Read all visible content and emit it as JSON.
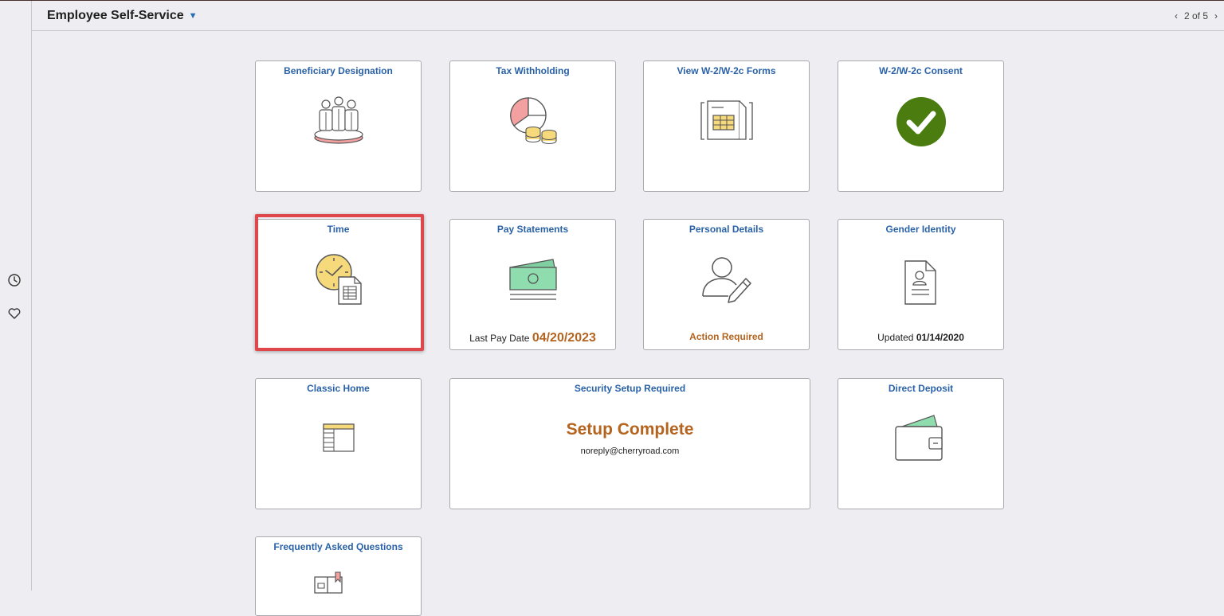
{
  "header": {
    "title": "Employee Self-Service",
    "pager": {
      "prev": "‹",
      "label": "2 of 5",
      "next": "›"
    }
  },
  "leftbar": {
    "icons": [
      "history-icon",
      "favorites-heart-icon"
    ]
  },
  "tiles": [
    {
      "title": "Beneficiary Designation",
      "icon": "people-on-platform-icon"
    },
    {
      "title": "Tax Withholding",
      "icon": "pie-chart-coins-icon"
    },
    {
      "title": "View W-2/W-2c Forms",
      "icon": "forms-document-icon"
    },
    {
      "title": "W-2/W-2c Consent",
      "icon": "green-checkmark-icon"
    },
    {
      "title": "Time",
      "icon": "clock-timesheet-icon"
    },
    {
      "title": "Pay Statements",
      "icon": "money-bill-icon",
      "footer_label": "Last Pay Date",
      "footer_value": "04/20/2023"
    },
    {
      "title": "Personal Details",
      "icon": "person-edit-icon",
      "footer_value": "Action Required"
    },
    {
      "title": "Gender Identity",
      "icon": "profile-document-icon",
      "footer_label": "Updated",
      "footer_value": "01/14/2020"
    },
    {
      "title": "Classic Home",
      "icon": "classic-page-icon"
    },
    {
      "title": "Security Setup Required",
      "headline": "Setup Complete",
      "email": "noreply@cherryroad.com"
    },
    {
      "title": "Direct Deposit",
      "icon": "wallet-icon"
    },
    {
      "title": "Frequently Asked Questions",
      "icon": "faq-book-icon"
    }
  ],
  "colors": {
    "accent_blue": "#2a62a8",
    "orange": "#b4641e",
    "highlight_red": "#e0474d",
    "check_green": "#4a7c0f"
  }
}
